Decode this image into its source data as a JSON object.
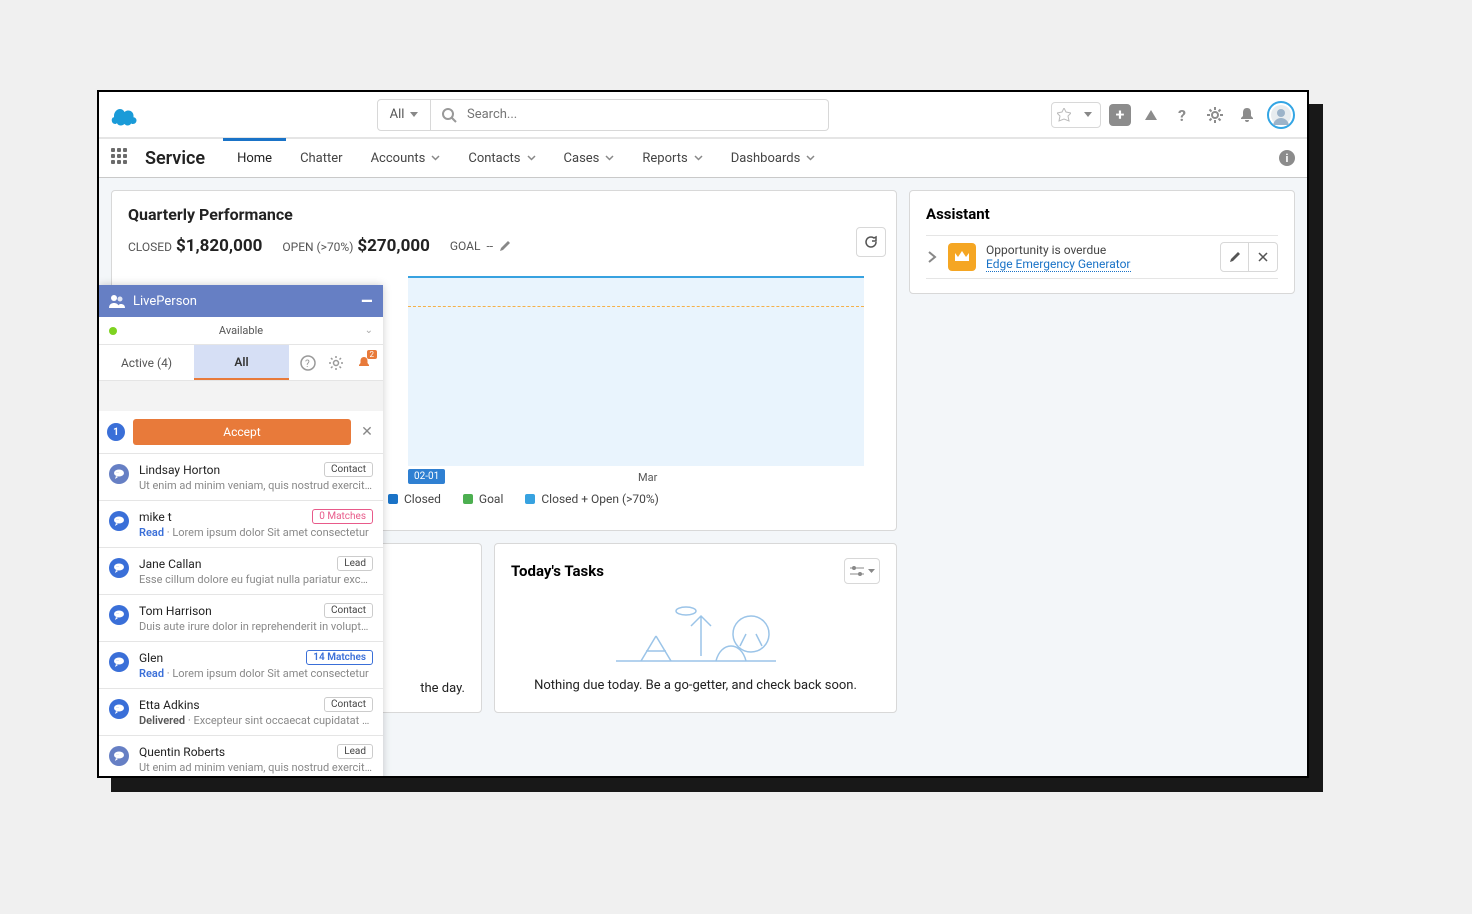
{
  "header": {
    "scope_label": "All",
    "search_placeholder": "Search..."
  },
  "nav": {
    "app_name": "Service",
    "tabs": [
      "Home",
      "Chatter",
      "Accounts",
      "Contacts",
      "Cases",
      "Reports",
      "Dashboards"
    ],
    "active": "Home"
  },
  "qp": {
    "title": "Quarterly Performance",
    "closed_label": "CLOSED",
    "closed_value": "$1,820,000",
    "open_label": "OPEN (>70%)",
    "open_value": "$270,000",
    "goal_label": "GOAL",
    "goal_value": "--"
  },
  "chart_data": {
    "type": "area",
    "date_marker": "02-01",
    "x_tick": "Mar",
    "series": [
      {
        "name": "Closed",
        "color": "#1a73c7"
      },
      {
        "name": "Goal",
        "color": "#4caf50"
      },
      {
        "name": "Closed + Open (>70%)",
        "color": "#37a2e0"
      }
    ]
  },
  "snippet_card_text": "the day.",
  "tasks": {
    "title": "Today's Tasks",
    "empty_msg": "Nothing due today. Be a go-getter, and check back soon."
  },
  "assistant": {
    "title": "Assistant",
    "item_line1": "Opportunity is overdue",
    "item_link": "Edge Emergency Generator"
  },
  "lp": {
    "title": "LivePerson",
    "status": "Available",
    "tab_active_label": "Active (4)",
    "tab_all_label": "All",
    "notif_count": "2",
    "accept_count": "1",
    "accept_label": "Accept",
    "conversations": [
      {
        "name": "Lindsay Horton",
        "pill": "Contact",
        "pill_style": "default",
        "status": "",
        "snippet": "Ut enim ad minim veniam, quis nostrud exercitation …",
        "bubble": "grey"
      },
      {
        "name": "mike t",
        "pill": "0 Matches",
        "pill_style": "pink",
        "status": "Read",
        "snippet": "Lorem ipsum dolor Sit amet consectetur",
        "bubble": "blue"
      },
      {
        "name": "Jane Callan",
        "pill": "Lead",
        "pill_style": "default",
        "status": "",
        "snippet": "Esse cillum dolore eu fugiat nulla pariatur excepte…",
        "bubble": "blue"
      },
      {
        "name": "Tom Harrison",
        "pill": "Contact",
        "pill_style": "default",
        "status": "",
        "snippet": "Duis aute irure dolor in reprehenderit in voluptate",
        "bubble": "blue"
      },
      {
        "name": "Glen",
        "pill": "14 Matches",
        "pill_style": "blue",
        "status": "Read",
        "snippet": "Lorem ipsum dolor Sit amet consectetur",
        "bubble": "blue"
      },
      {
        "name": "Etta Adkins",
        "pill": "Contact",
        "pill_style": "default",
        "status": "Delivered",
        "snippet": "Excepteur sint occaecat cupidatat non p…",
        "bubble": "blue"
      },
      {
        "name": "Quentin Roberts",
        "pill": "Lead",
        "pill_style": "default",
        "status": "",
        "snippet": "Ut enim ad minim veniam, quis nostrud exercitation …",
        "bubble": "grey"
      }
    ]
  },
  "footer_tab": "LivePerson"
}
